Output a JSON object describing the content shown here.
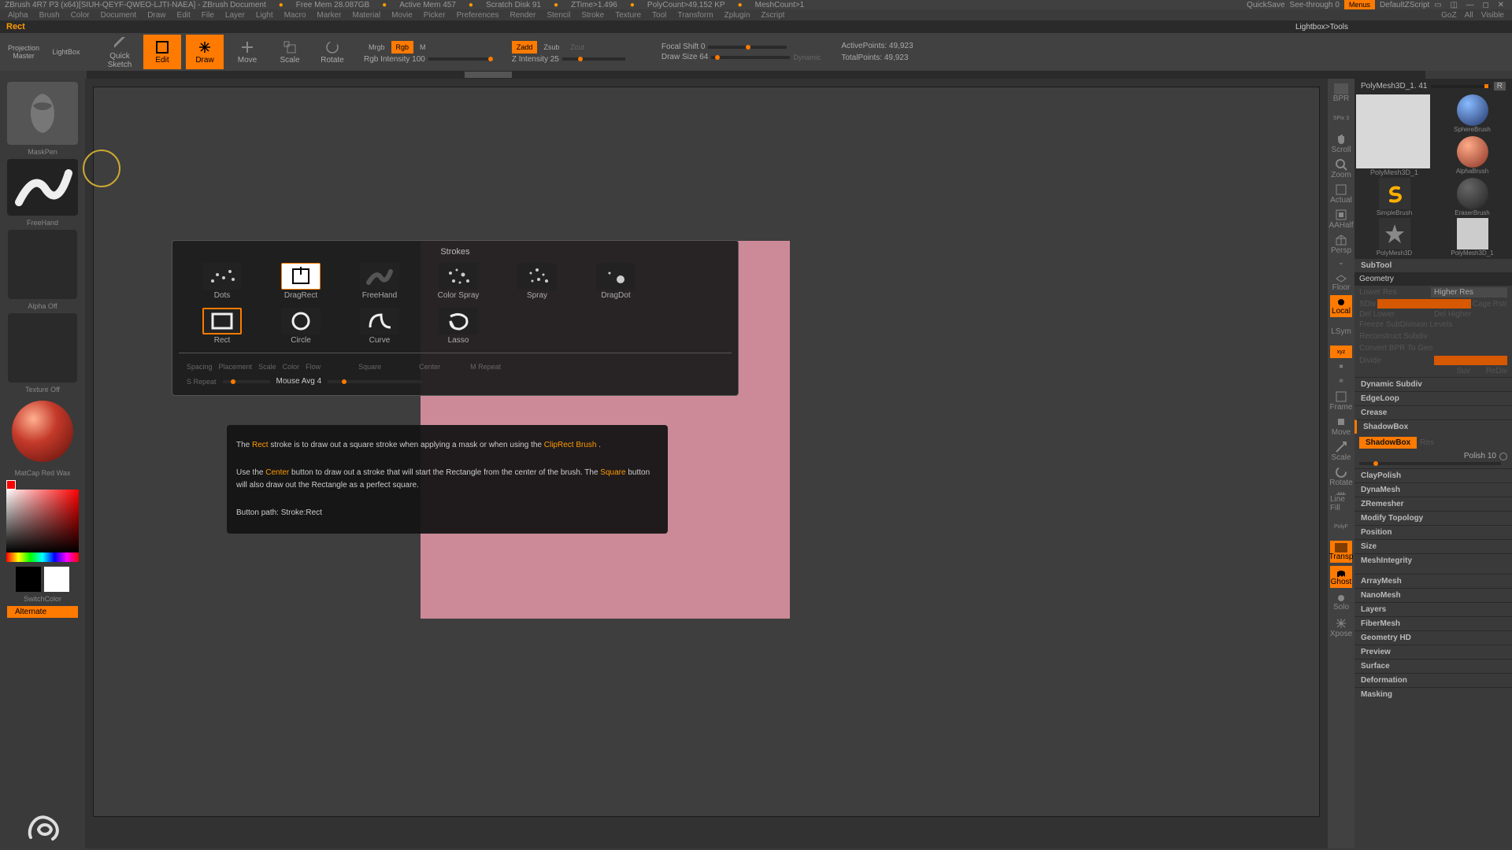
{
  "title_bar": {
    "app": "ZBrush 4R7 P3 (x64)[SIUH-QEYF-QWEO-LJTI-NAEA] - ZBrush Document",
    "free_mem": "Free Mem 28.087GB",
    "active_mem": "Active Mem 457",
    "scratch": "Scratch Disk 91",
    "ztime": "ZTime>1.496",
    "polycount": "PolyCount>49.152 KP",
    "meshcount": "MeshCount>1",
    "quicksave": "QuickSave",
    "see_through": "See-through 0",
    "menus": "Menus",
    "script": "DefaultZScript"
  },
  "menu": [
    "Alpha",
    "Brush",
    "Color",
    "Document",
    "Draw",
    "Edit",
    "File",
    "Layer",
    "Light",
    "Macro",
    "Marker",
    "Material",
    "Movie",
    "Picker",
    "Preferences",
    "Render",
    "Stencil",
    "Stroke",
    "Texture",
    "Tool",
    "Transform",
    "Zplugin",
    "Zscript"
  ],
  "goz": {
    "goz": "GoZ",
    "all": "All",
    "visible": "Visible"
  },
  "info_bar": {
    "current": "Rect"
  },
  "top_tools": {
    "proj_master": "Projection\nMaster",
    "lightbox": "LightBox",
    "quick_sketch": "Quick Sketch",
    "edit": "Edit",
    "draw": "Draw",
    "move": "Move",
    "scale": "Scale",
    "rotate": "Rotate",
    "mrgb": "Mrgb",
    "rgb": "Rgb",
    "m": "M",
    "rgb_intensity": "Rgb Intensity 100",
    "zadd": "Zadd",
    "zsub": "Zsub",
    "zcut": "Zcut",
    "z_intensity": "Z Intensity 25",
    "focal": "Focal Shift 0",
    "draw_size": "Draw Size 64",
    "dynamic": "Dynamic",
    "active_points": "ActivePoints: 49,923",
    "total_points": "TotalPoints: 49,923"
  },
  "left_col": {
    "brush_name": "MaskPen",
    "stroke_name": "FreeHand",
    "alpha": "Alpha  Off",
    "texture": "Texture Off",
    "material": "MatCap Red Wax",
    "gradient": "Gradient",
    "switch": "SwitchColor",
    "alternate": "Alternate"
  },
  "strokes_popup": {
    "title": "Strokes",
    "items": [
      "Dots",
      "DragRect",
      "FreeHand",
      "Color Spray",
      "Spray",
      "DragDot",
      "Rect",
      "Circle",
      "Curve",
      "Lasso"
    ],
    "sliders": {
      "spacing": "Spacing",
      "placement": "Placement",
      "scale": "Scale",
      "color": "Color",
      "flow": "Flow",
      "square": "Square",
      "center": "Center",
      "mrepeat": "M Repeat",
      "srepeat": "S Repeat",
      "mouse": "Mouse Avg 4"
    }
  },
  "tooltip": {
    "l1a": "The ",
    "rect": "Rect",
    "l1b": " stroke is to draw out a square stroke when applying a mask or when using the ",
    "clip": "ClipRect Brush",
    "l1c": " .",
    "l2a": "Use the ",
    "center": "Center",
    "l2b": " button to draw out a stroke that will start the Rectangle from the center of the brush. The ",
    "square": "Square",
    "l2c": " button will also draw out the Rectangle as a perfect square.",
    "l3": "Button path: Stroke:Rect"
  },
  "right_tools": {
    "bpr": "BPR",
    "spix": "SPix 3",
    "scroll": "Scroll",
    "zoom": "Zoom",
    "actual": "Actual",
    "aahalf": "AAHalf",
    "persp": "Persp",
    "floor": "Floor",
    "local": "Local",
    "lsym": "LSym",
    "xyz": "xyz",
    "frame": "Frame",
    "move": "Move",
    "scale": "Scale",
    "rotate": "Rotate",
    "linefill": "Line Fill",
    "polyf": "PolyF",
    "transp": "Transp",
    "ghost": "Ghost",
    "solo": "Solo",
    "xpose": "Xpose"
  },
  "right_panel": {
    "lightbox_tools": "Lightbox>Tools",
    "current_tool": "PolyMesh3D_1. 41",
    "r": "R",
    "tool_names": [
      "PolyMesh3D_1",
      "SphereBrush",
      "PolyMesh3D_1",
      "AlphaBrush",
      "SimpleBrush",
      "EraserBrush",
      "PolyMesh3D",
      "PolyMesh3D_1"
    ],
    "subtool": "SubTool",
    "geometry": "Geometry",
    "geo": {
      "lower": "Lower Res",
      "higher": "Higher Res",
      "sdiv": "SDiv",
      "cage": "Cage",
      "rstr": "Rstr",
      "del_lower": "Del Lower",
      "del_higher": "Del Higher",
      "freeze": "Freeze SubDivision Levels",
      "reconstruct": "Reconstruct Subdiv",
      "convert": "Convert BPR To Geo",
      "divide": "Divide",
      "suv": "Suv",
      "rediv": "ReDiv"
    },
    "sections": [
      "Dynamic Subdiv",
      "EdgeLoop",
      "Crease",
      "ShadowBox"
    ],
    "shadowbox": {
      "btn": "ShadowBox",
      "res": "Res",
      "polish": "Polish 10"
    },
    "more": [
      "ClayPolish",
      "DynaMesh",
      "ZRemesher",
      "Modify Topology",
      "Position",
      "Size",
      "MeshIntegrity",
      "ArrayMesh",
      "NanoMesh",
      "Layers",
      "FiberMesh",
      "Geometry HD",
      "Preview",
      "Surface",
      "Deformation",
      "Masking"
    ]
  }
}
